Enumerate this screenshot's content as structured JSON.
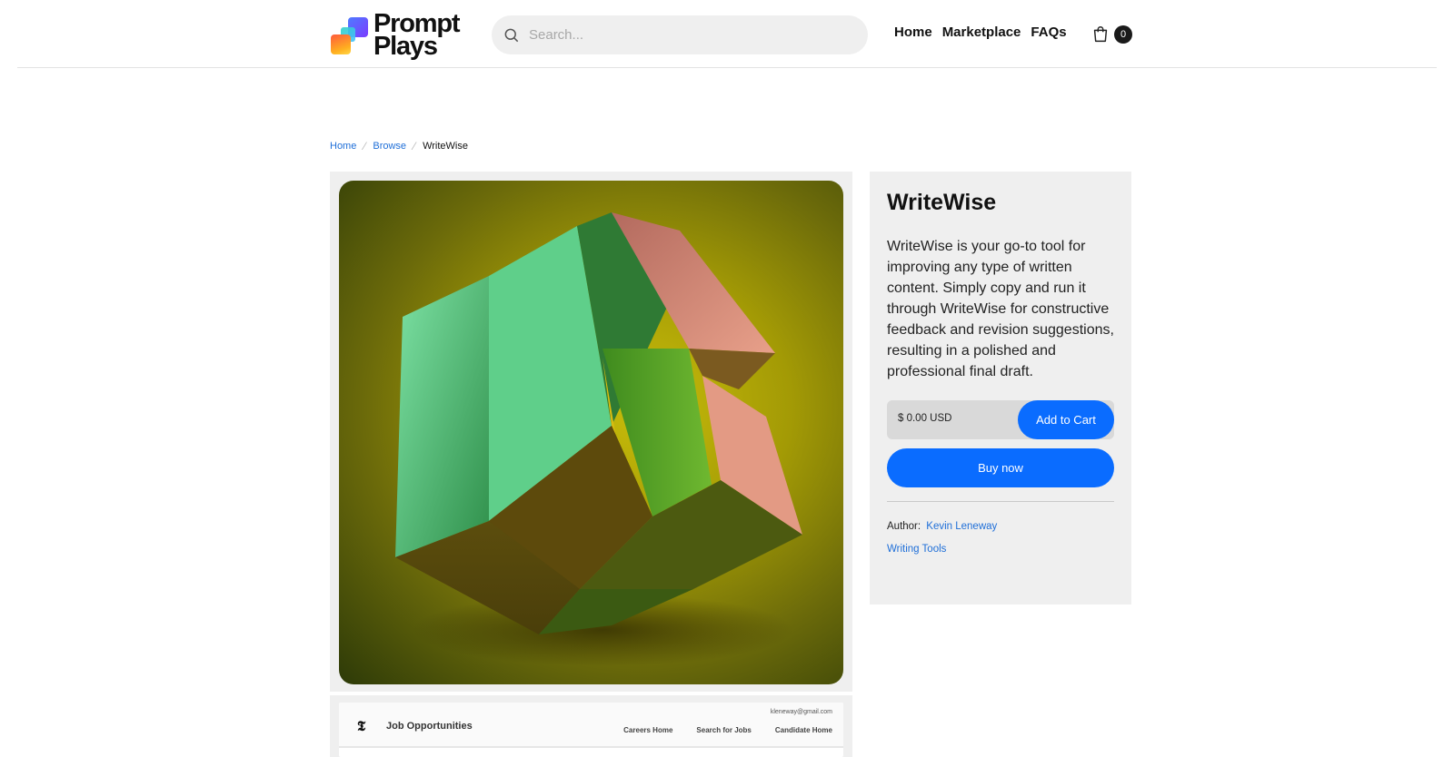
{
  "header": {
    "logo_line1": "Prompt",
    "logo_line2": "Plays",
    "search_placeholder": "Search...",
    "nav": [
      "Home",
      "Marketplace",
      "FAQs"
    ],
    "cart_count": "0"
  },
  "breadcrumb": {
    "items": [
      "Home",
      "Browse"
    ],
    "current": "WriteWise"
  },
  "product": {
    "title": "WriteWise",
    "description": "WriteWise is your go-to tool for improving any type of written content. Simply copy and run it through WriteWise for constructive feedback and revision suggestions, resulting in a polished and professional final draft.",
    "price": "$ 0.00 USD",
    "add_to_cart_label": "Add to Cart",
    "buy_now_label": "Buy now",
    "author_label": "Author:",
    "author_name": "Kevin Leneway",
    "category": "Writing Tools",
    "accent_color": "#0a6cff"
  },
  "preview_thumb": {
    "title": "Job Opportunities",
    "email": "kleneway@gmail.com",
    "links": [
      "Careers Home",
      "Search for Jobs",
      "Candidate Home"
    ],
    "logo_glyph": "𝕿"
  }
}
